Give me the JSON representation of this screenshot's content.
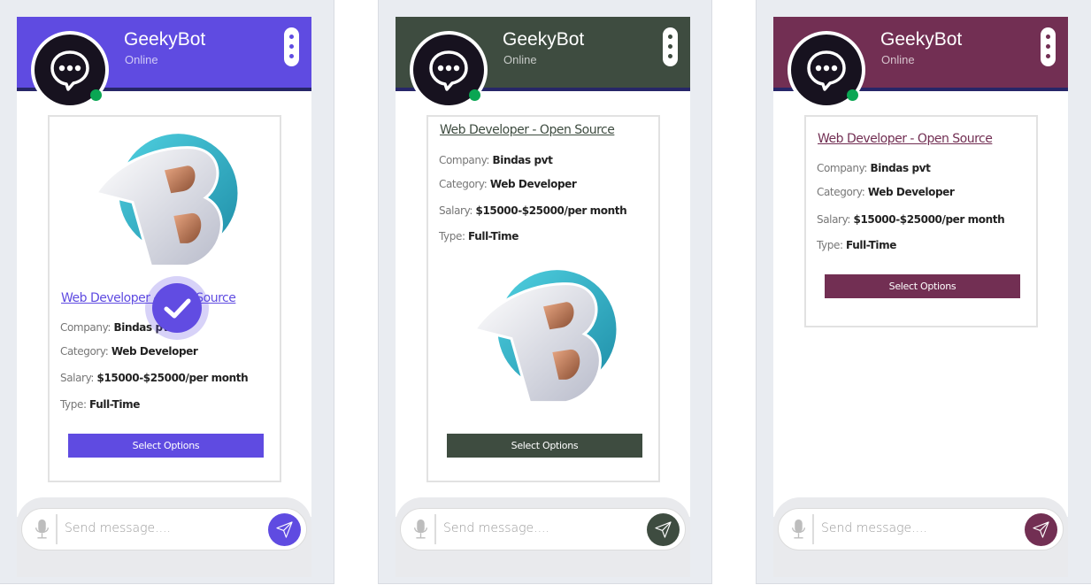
{
  "panels": [
    {
      "theme_color": "#5f4be1",
      "bot_name": "GeekyBot",
      "status": "Online",
      "job": {
        "title": "Web Developer - Open Source",
        "company_label": "Company:",
        "company": "Bindas pvt",
        "category_label": "Category:",
        "category": "Web Developer",
        "salary_label": "Salary:",
        "salary": "$15000-$25000/per month",
        "type_label": "Type:",
        "type": "Full-Time"
      },
      "select_button": "Select Options",
      "input_placeholder": "Send message....",
      "selected": true
    },
    {
      "theme_color": "#3e4c40",
      "bot_name": "GeekyBot",
      "status": "Online",
      "job": {
        "title": "Web Developer - Open Source",
        "company_label": "Company:",
        "company": "Bindas pvt",
        "category_label": "Category:",
        "category": "Web Developer",
        "salary_label": "Salary:",
        "salary": "$15000-$25000/per month",
        "type_label": "Type:",
        "type": "Full-Time"
      },
      "select_button": "Select Options",
      "input_placeholder": "Send message...."
    },
    {
      "theme_color": "#722f53",
      "bot_name": "GeekyBot",
      "status": "Online",
      "job": {
        "title": "Web Developer - Open Source",
        "company_label": "Company:",
        "company": "Bindas pvt",
        "category_label": "Category:",
        "category": "Web Developer",
        "salary_label": "Salary:",
        "salary": "$15000-$25000/per month",
        "type_label": "Type:",
        "type": "Full-Time"
      },
      "select_button": "Select Options",
      "input_placeholder": "Send message...."
    }
  ],
  "icons": {
    "avatar": "chat-bubble-dots-icon",
    "menu": "vertical-dots-icon",
    "mic": "microphone-icon",
    "send": "paper-plane-icon",
    "check": "checkmark-icon",
    "logo": "b-letter-logo"
  }
}
